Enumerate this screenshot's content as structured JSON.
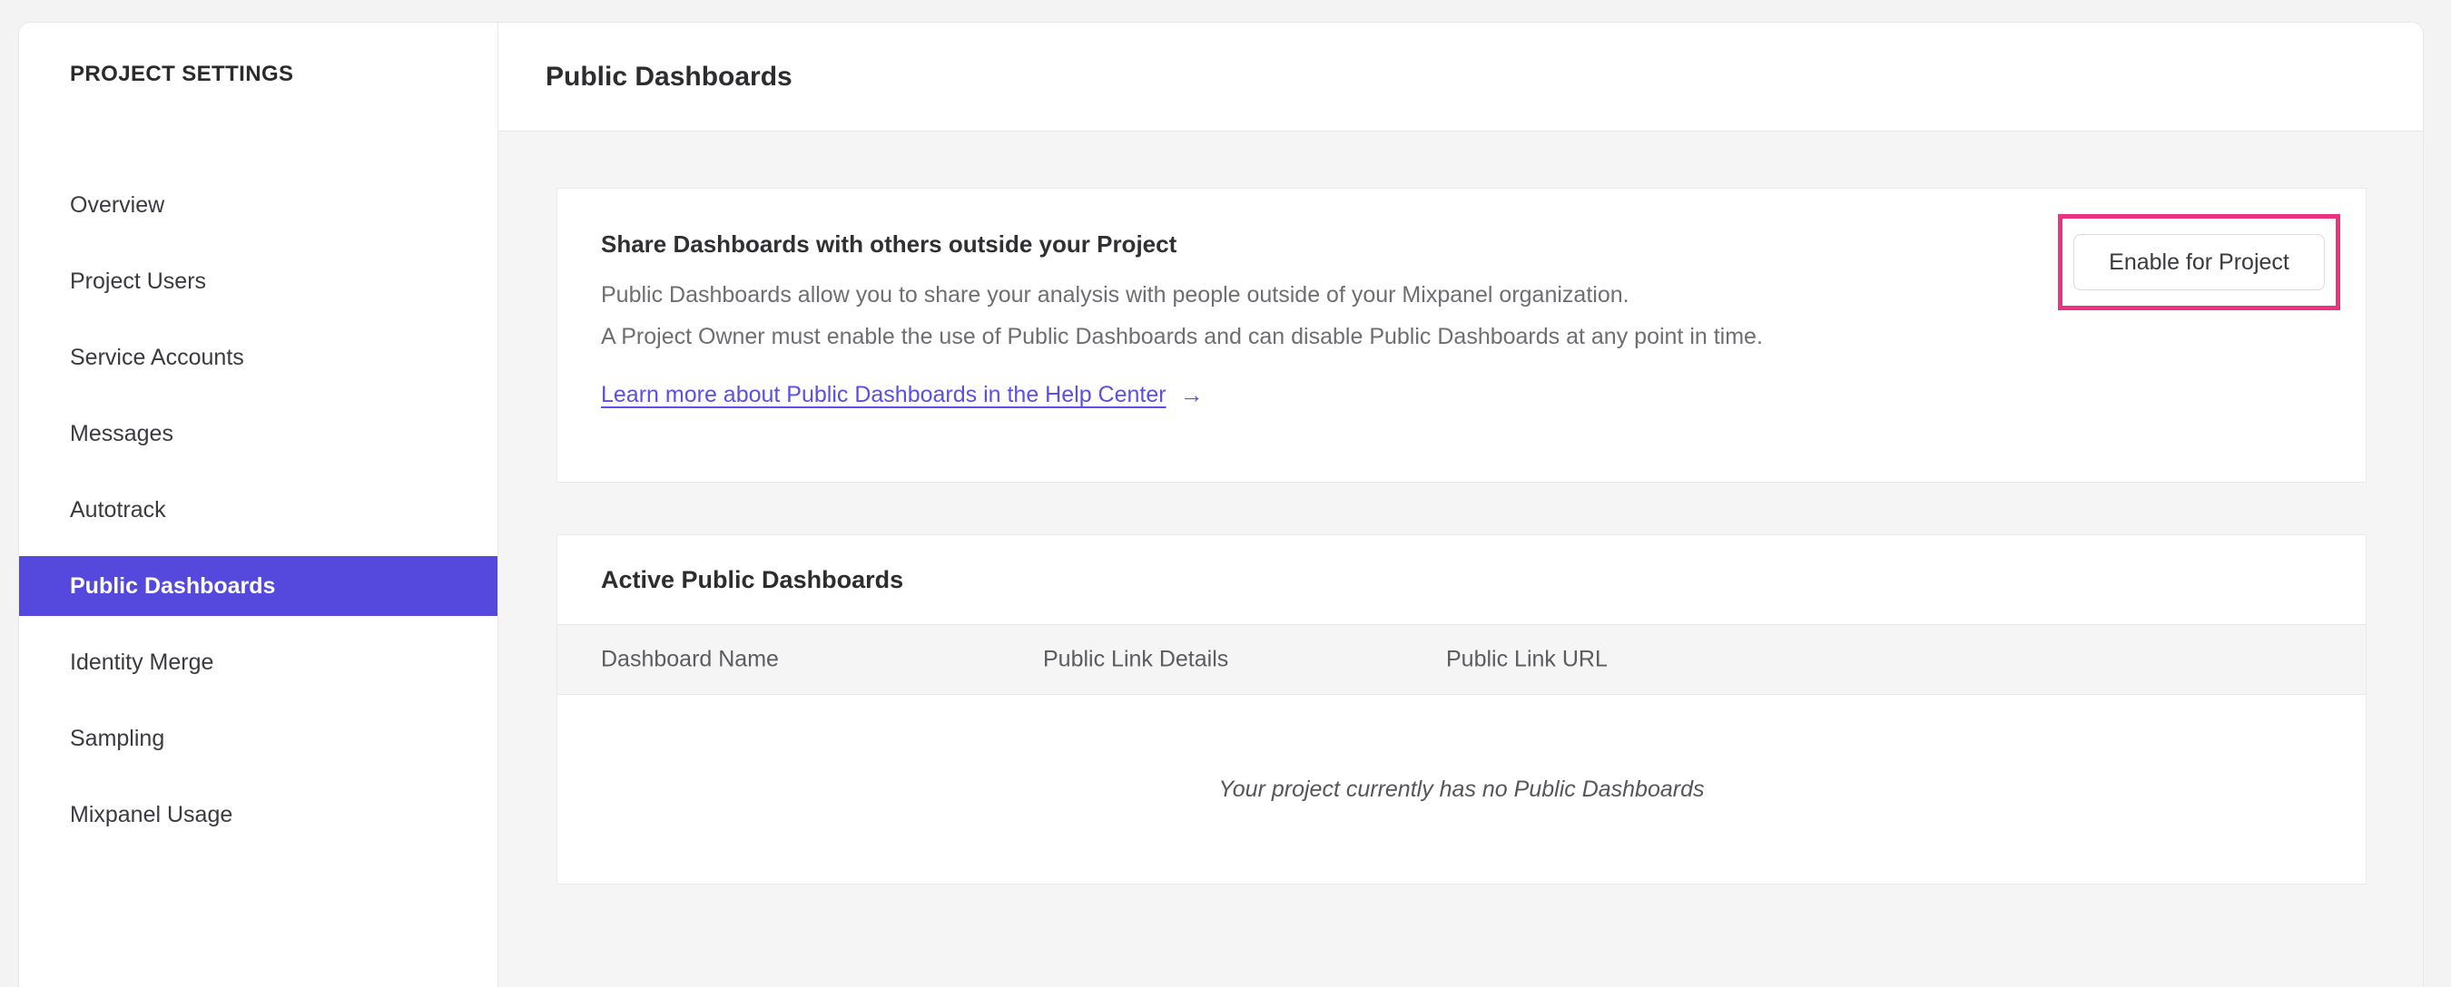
{
  "colors": {
    "accent": "#5449DC",
    "link": "#5A4FE8",
    "highlight": "#EB3381",
    "page_background": "#f3f3f4",
    "content_background": "#f5f5f6"
  },
  "sidebar": {
    "title": "PROJECT SETTINGS",
    "items": [
      {
        "label": "Overview",
        "selected": false
      },
      {
        "label": "Project Users",
        "selected": false
      },
      {
        "label": "Service Accounts",
        "selected": false
      },
      {
        "label": "Messages",
        "selected": false
      },
      {
        "label": "Autotrack",
        "selected": false
      },
      {
        "label": "Public Dashboards",
        "selected": true
      },
      {
        "label": "Identity Merge",
        "selected": false
      },
      {
        "label": "Sampling",
        "selected": false
      },
      {
        "label": "Mixpanel Usage",
        "selected": false
      }
    ]
  },
  "header": {
    "title": "Public Dashboards"
  },
  "share_card": {
    "heading": "Share Dashboards with others outside your Project",
    "body_line1": "Public Dashboards allow you to share your analysis with people outside of your Mixpanel organization.",
    "body_line2": "A Project Owner must enable the use of Public Dashboards and can disable Public Dashboards at any point in time.",
    "link_label": "Learn more about Public Dashboards in the Help Center",
    "link_arrow": "→",
    "button_label": "Enable for Project"
  },
  "active_card": {
    "heading": "Active Public Dashboards",
    "columns": [
      "Dashboard Name",
      "Public Link Details",
      "Public Link URL"
    ],
    "empty_message": "Your project currently has no Public Dashboards"
  }
}
